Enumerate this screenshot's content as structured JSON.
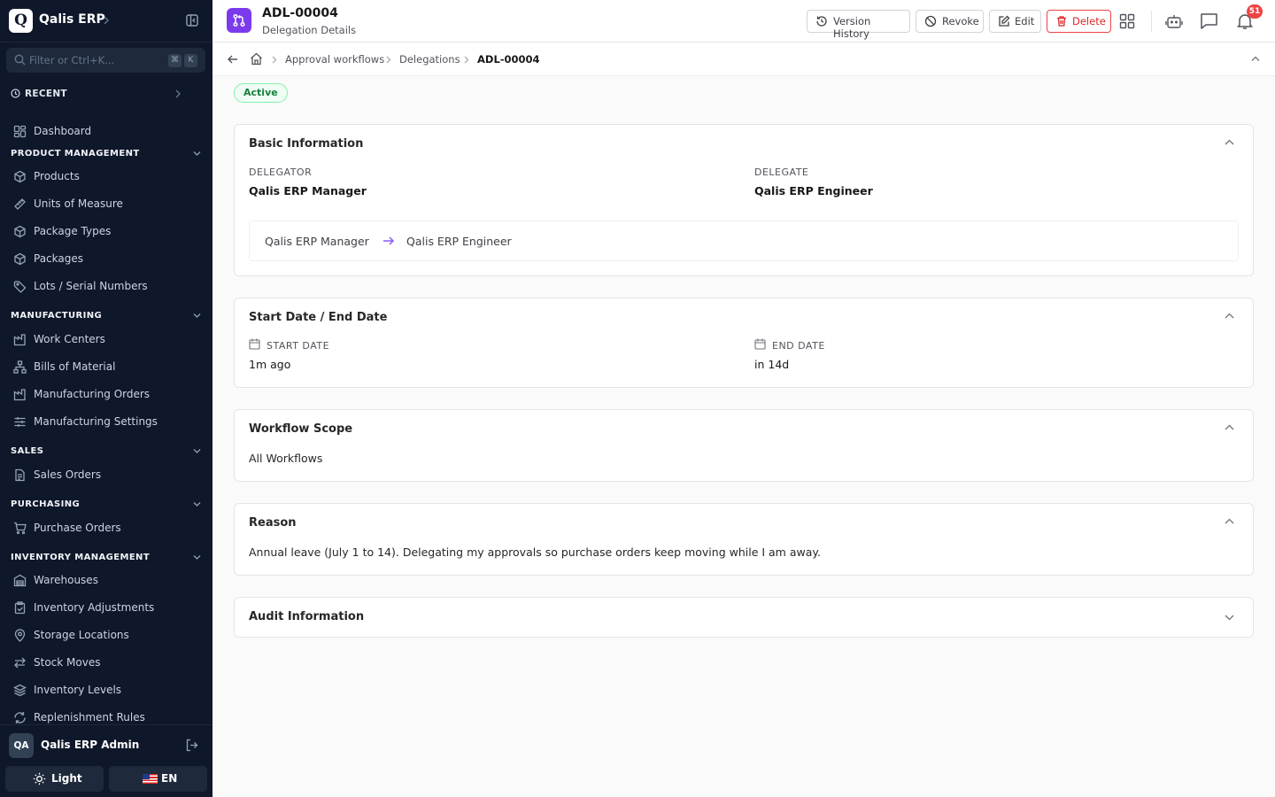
{
  "app": {
    "name": "Qalis ERP",
    "logo_letter": "Q"
  },
  "sidebar": {
    "filter_placeholder": "Filter or Ctrl+K...",
    "kbd_keys": [
      "⌘",
      "K"
    ],
    "recent_label": "RECENT",
    "dashboard_label": "Dashboard",
    "sections": {
      "product_management": {
        "title": "PRODUCT MANAGEMENT",
        "items": [
          "Products",
          "Units of Measure",
          "Package Types",
          "Packages",
          "Lots / Serial Numbers"
        ]
      },
      "manufacturing": {
        "title": "MANUFACTURING",
        "items": [
          "Work Centers",
          "Bills of Material",
          "Manufacturing Orders",
          "Manufacturing Settings"
        ]
      },
      "sales": {
        "title": "SALES",
        "items": [
          "Sales Orders"
        ]
      },
      "purchasing": {
        "title": "PURCHASING",
        "items": [
          "Purchase Orders"
        ]
      },
      "inventory_management": {
        "title": "INVENTORY MANAGEMENT",
        "items": [
          "Warehouses",
          "Inventory Adjustments",
          "Storage Locations",
          "Stock Moves",
          "Inventory Levels",
          "Replenishment Rules"
        ]
      }
    },
    "user": {
      "initials": "QA",
      "name": "Qalis ERP Admin"
    },
    "theme_label": "Light",
    "lang_label": "EN"
  },
  "header": {
    "title": "ADL-00004",
    "subtitle": "Delegation Details",
    "buttons": {
      "version_history": "Version History",
      "revoke": "Revoke",
      "edit": "Edit",
      "delete": "Delete"
    },
    "notification_count": "51"
  },
  "breadcrumb": {
    "items": [
      "Approval workflows",
      "Delegations",
      "ADL-00004"
    ]
  },
  "status": "Active",
  "basic_info": {
    "title": "Basic Information",
    "delegator_label": "DELEGATOR",
    "delegator_value": "Qalis ERP Manager",
    "delegate_label": "DELEGATE",
    "delegate_value": "Qalis ERP Engineer",
    "flow_from": "Qalis ERP Manager",
    "flow_to": "Qalis ERP Engineer"
  },
  "dates": {
    "title": "Start Date / End Date",
    "start_label": "START DATE",
    "start_value": "1m ago",
    "end_label": "END DATE",
    "end_value": "in 14d"
  },
  "workflow_scope": {
    "title": "Workflow Scope",
    "value": "All Workflows"
  },
  "reason": {
    "title": "Reason",
    "text": "Annual leave (July 1 to 14). Delegating my approvals so purchase orders keep moving while I am away."
  },
  "audit": {
    "title": "Audit Information"
  },
  "colors": {
    "sidebar_bg": "#0f172a",
    "accent": "#7c3aed",
    "danger": "#dc2626",
    "success": "#15803d"
  }
}
